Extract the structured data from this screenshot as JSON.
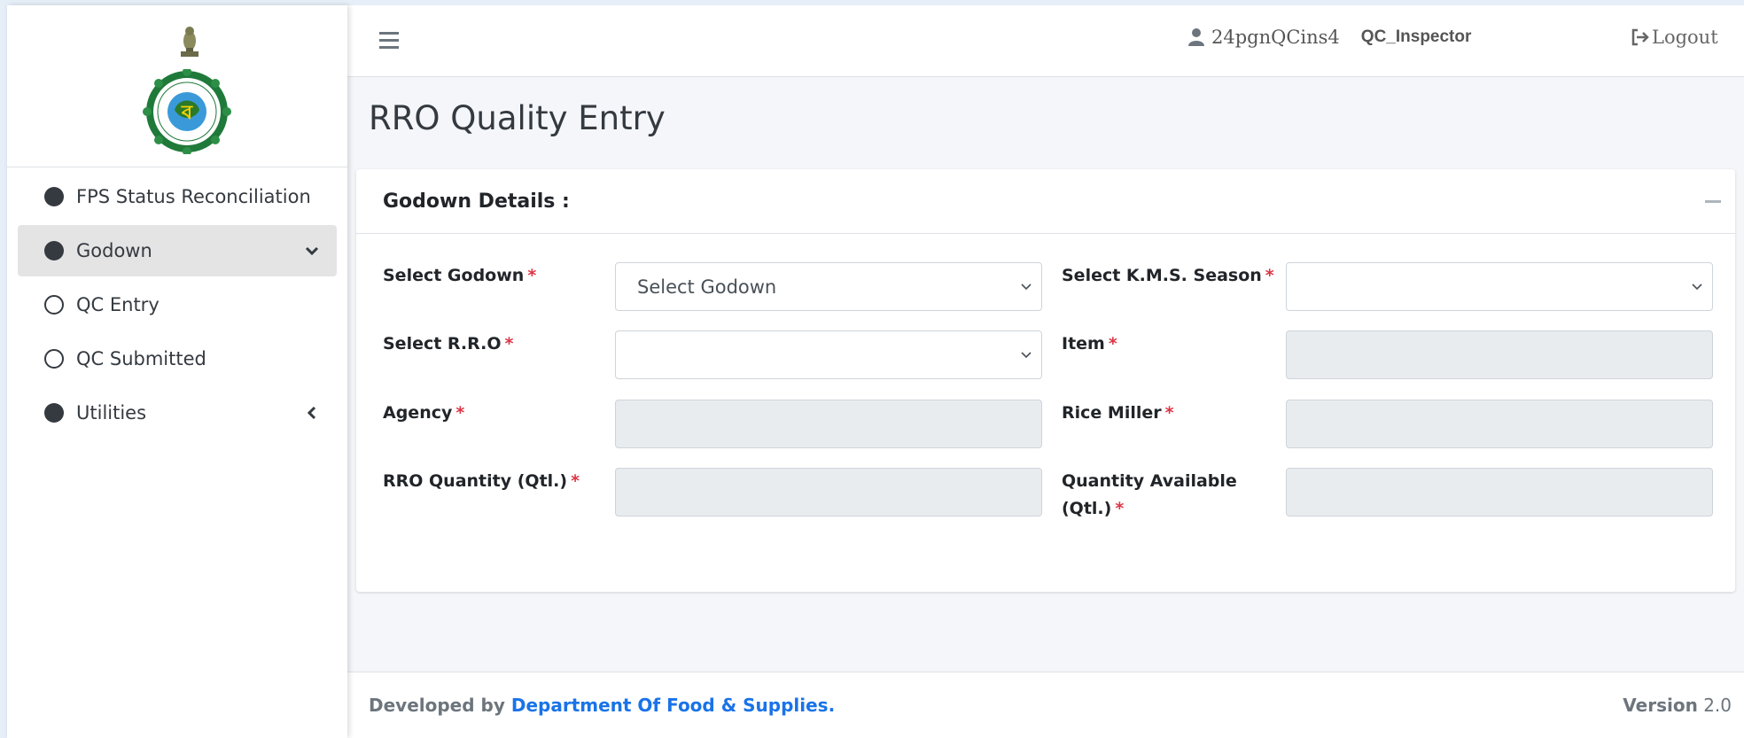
{
  "sidebar": {
    "items": [
      {
        "label": "FPS Status Reconciliation",
        "icon": "circle-filled-icon"
      },
      {
        "label": "Godown",
        "icon": "circle-filled-icon",
        "active": true,
        "chevron": "chevron-down-icon"
      },
      {
        "label": "QC Entry",
        "icon": "circle-outline-icon"
      },
      {
        "label": "QC Submitted",
        "icon": "circle-outline-icon"
      },
      {
        "label": "Utilities",
        "icon": "circle-filled-icon",
        "chevron": "chevron-left-icon"
      }
    ]
  },
  "topbar": {
    "username": "24pgnQCins4",
    "role": "QC_Inspector",
    "logout_label": "Logout"
  },
  "page": {
    "title": "RRO Quality Entry"
  },
  "card": {
    "title": "Godown Details :",
    "fields": {
      "select_godown": {
        "label": "Select Godown",
        "value": "Select Godown",
        "required": "*"
      },
      "kms_season": {
        "label": "Select K.M.S. Season",
        "value": "",
        "required": "*"
      },
      "select_rro": {
        "label": "Select R.R.O",
        "value": "",
        "required": "*"
      },
      "item": {
        "label": "Item",
        "value": "",
        "required": "*"
      },
      "agency": {
        "label": "Agency",
        "value": "",
        "required": "*"
      },
      "rice_miller": {
        "label": "Rice Miller",
        "value": "",
        "required": "*"
      },
      "rro_quantity": {
        "label": "RRO Quantity (Qtl.)",
        "value": "",
        "required": "*"
      },
      "quantity_available": {
        "label_line1": "Quantity Available",
        "label_line2": "(Qtl.)",
        "value": "",
        "required": "*"
      }
    }
  },
  "footer": {
    "developed_by": "Developed by",
    "department": "Department Of Food & Supplies.",
    "version_label": "Version",
    "version_number": "2.0"
  },
  "colors": {
    "required": "#dc3545",
    "link": "#1a73e8",
    "active_nav_bg": "#e4e4e4",
    "readonly_bg": "#e9ecef"
  }
}
